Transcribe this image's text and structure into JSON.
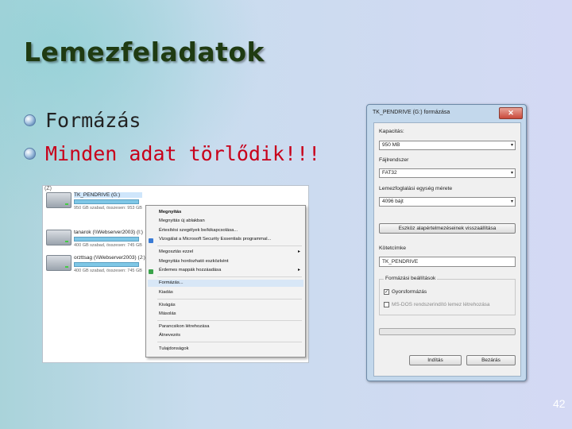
{
  "slide": {
    "title": "Lemezfeladatok",
    "bullets": [
      "Formázás",
      "Minden adat törlődik!!!"
    ],
    "page_number": "42"
  },
  "explorer": {
    "top_label": "(Z)",
    "drives": [
      {
        "name": "TK_PENDRIVE (G:)",
        "info": "950 GB szabad, összesen: 953 GB"
      },
      {
        "name": "tanarok (\\\\Webserver2003) (I:)",
        "info": "400 GB szabad, összesen: 745 GB"
      },
      {
        "name": "orzttsag (\\\\Webserver2003) (J:)",
        "info": "400 GB szabad, összesen: 745 GB"
      }
    ]
  },
  "context_menu": {
    "items": [
      {
        "label": "Megnyitás",
        "bold": true
      },
      {
        "label": "Megnyitás új ablakban"
      },
      {
        "label": "Értesítési szegélyek be/kikapcsolása..."
      },
      {
        "label": "Vizsgálat a Microsoft Security Essentials programmal..."
      },
      {
        "label": "Megosztás ezzel",
        "submenu": true
      },
      {
        "label": "Megnyitás hordozható eszközként"
      },
      {
        "label": "Érdemes mappák hozzáadása",
        "submenu": true
      },
      {
        "label": "Formázás...",
        "active": true
      },
      {
        "label": "Kiadás"
      },
      {
        "label": "Kivágás"
      },
      {
        "label": "Másolás"
      },
      {
        "label": "Parancsikon létrehozása"
      },
      {
        "label": "Átnevezés"
      },
      {
        "label": "Tulajdonságok"
      }
    ]
  },
  "format_dialog": {
    "title": "TK_PENDRIVE (G:) formázása",
    "close_label": "✕",
    "capacity_label": "Kapacitás:",
    "capacity_value": "950 MB",
    "filesystem_label": "Fájlrendszer",
    "filesystem_value": "FAT32",
    "allocation_label": "Lemezfoglalási egység mérete",
    "allocation_value": "4096 bájt",
    "restore_button": "Eszköz alapértelmezéseinek visszaállítása",
    "volume_label": "Kötetcímke",
    "volume_value": "TK_PENDRIVE",
    "options_group": "Formázási beállítások",
    "quick_format": "Gyorsformázás",
    "quick_format_checked": "✓",
    "msdos": "MS-DOS rendszerindító lemez létrehozása",
    "start_button": "Indítás",
    "close_button": "Bezárás"
  }
}
